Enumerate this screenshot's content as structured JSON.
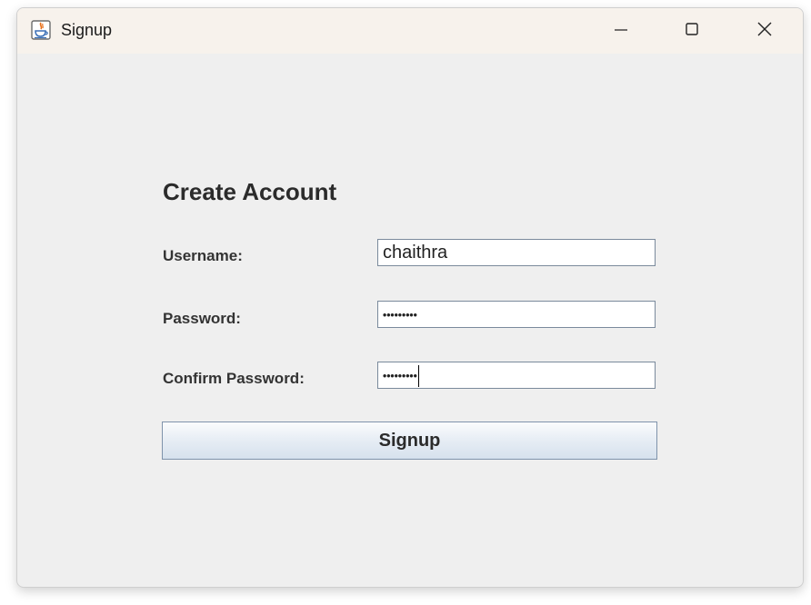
{
  "window": {
    "title": "Signup",
    "icon": "java-cup-icon",
    "controls": {
      "minimize": "minimize-icon",
      "maximize": "maximize-icon",
      "close": "close-icon"
    }
  },
  "form": {
    "heading": "Create Account",
    "username": {
      "label": "Username:",
      "value": "chaithra"
    },
    "password": {
      "label": "Password:",
      "masked_value": "•••••••••"
    },
    "confirm_password": {
      "label": "Confirm Password:",
      "masked_value": "•••••••••"
    },
    "submit_label": "Signup"
  },
  "colors": {
    "titlebar": "#f7f2ec",
    "window_bg": "#efefef",
    "field_border": "#7a8a9c",
    "button_border": "#7f93ab"
  }
}
